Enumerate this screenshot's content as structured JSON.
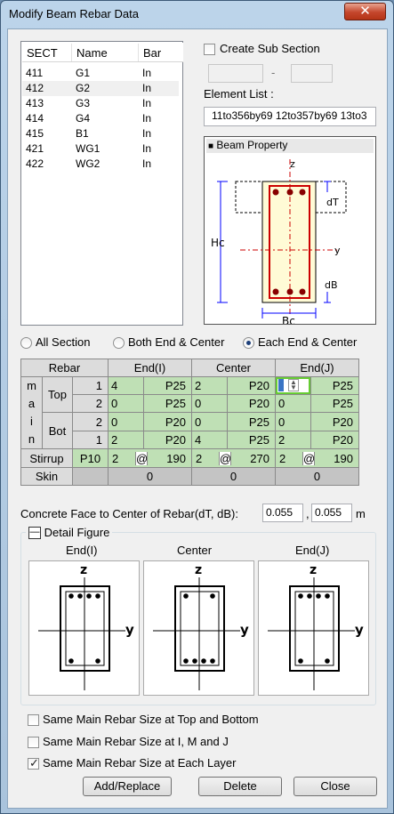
{
  "window": {
    "title": "Modify Beam Rebar Data",
    "close_glyph": "✕"
  },
  "sections": {
    "headers": [
      "SECT",
      "Name",
      "Bar"
    ],
    "rows": [
      [
        "411",
        "G1",
        "In"
      ],
      [
        "412",
        "G2",
        "In"
      ],
      [
        "413",
        "G3",
        "In"
      ],
      [
        "414",
        "G4",
        "In"
      ],
      [
        "415",
        "B1",
        "In"
      ],
      [
        "421",
        "WG1",
        "In"
      ],
      [
        "422",
        "WG2",
        "In"
      ]
    ],
    "selected_index": 1
  },
  "sub_section": {
    "label": "Create Sub Section",
    "checked": false,
    "from": "",
    "to": "",
    "dash": "-"
  },
  "element_list": {
    "label": "Element List :",
    "value": "11to356by69 12to357by69 13to3"
  },
  "beam_property": {
    "title": "Beam Property",
    "labels": {
      "z": "z",
      "y": "y",
      "hc": "Hc",
      "bc": "Bc",
      "dt": "dT",
      "db": "dB"
    }
  },
  "position_options": [
    {
      "label": "All Section",
      "checked": false
    },
    {
      "label": "Both End & Center",
      "checked": false
    },
    {
      "label": "Each End & Center",
      "checked": true
    }
  ],
  "rebar_table": {
    "headers": {
      "rebar": "Rebar",
      "end_i": "End(I)",
      "center": "Center",
      "end_j": "End(J)"
    },
    "main_label": [
      "m",
      "a",
      "i",
      "n"
    ],
    "top_label": "Top",
    "bot_label": "Bot",
    "rows": [
      {
        "layer": "1",
        "i_num": "4",
        "i_size": "P25",
        "c_num": "2",
        "c_size": "P20",
        "j_num": "",
        "j_size": "P25"
      },
      {
        "layer": "2",
        "i_num": "0",
        "i_size": "P25",
        "c_num": "0",
        "c_size": "P20",
        "j_num": "0",
        "j_size": "P25"
      },
      {
        "layer": "2",
        "i_num": "0",
        "i_size": "P20",
        "c_num": "0",
        "c_size": "P25",
        "j_num": "0",
        "j_size": "P20"
      },
      {
        "layer": "1",
        "i_num": "2",
        "i_size": "P20",
        "c_num": "4",
        "c_size": "P25",
        "j_num": "2",
        "j_size": "P20"
      }
    ],
    "stirrup": {
      "label": "Stirrup",
      "size": "P10",
      "i_legs": "2",
      "i_spacing": "190",
      "c_legs": "2",
      "c_spacing": "270",
      "j_legs": "2",
      "j_spacing": "190",
      "at": "@"
    },
    "skin": {
      "label": "Skin",
      "i": "0",
      "c": "0",
      "j": "0"
    }
  },
  "concrete_face": {
    "label": "Concrete Face to Center of Rebar(dT, dB):",
    "dt": "0.055",
    "db": "0.055",
    "sep": ",",
    "unit": "m"
  },
  "detail_figure": {
    "label": "Detail Figure",
    "toggle": "—",
    "headers": [
      "End(I)",
      "Center",
      "End(J)"
    ],
    "axis_z": "z",
    "axis_y": "y"
  },
  "options": [
    {
      "label": "Same Main Rebar Size at Top and Bottom",
      "checked": false
    },
    {
      "label": "Same Main Rebar Size at I, M and J",
      "checked": false
    },
    {
      "label": "Same Main Rebar Size at Each Layer",
      "checked": true
    }
  ],
  "buttons": {
    "add_replace": "Add/Replace",
    "delete": "Delete",
    "close": "Close"
  }
}
